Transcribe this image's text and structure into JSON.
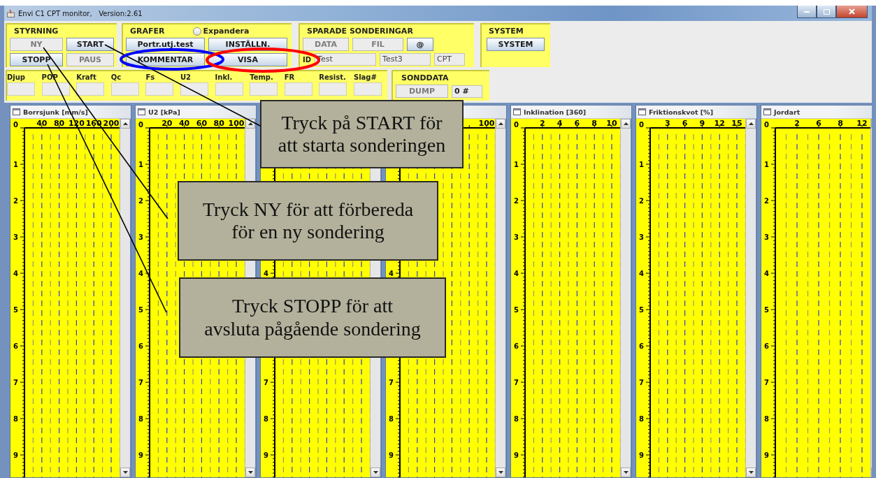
{
  "window": {
    "title": "Envi C1 CPT monitor,   Version:2.61"
  },
  "styrning": {
    "title": "STYRNING",
    "buttons": [
      {
        "label": "NY",
        "disabled": true
      },
      {
        "label": "START",
        "disabled": false
      },
      {
        "label": "STOPP",
        "disabled": false
      },
      {
        "label": "PAUS",
        "disabled": true
      }
    ]
  },
  "grafer": {
    "title": "GRAFER",
    "expand": {
      "label": "Expandera",
      "checked": false
    },
    "buttons": [
      {
        "label": "Portr.utj.test",
        "disabled": false
      },
      {
        "label": "INSTÄLLN.",
        "disabled": false
      },
      {
        "label": "KOMMENTAR",
        "disabled": false
      },
      {
        "label": "VISA",
        "disabled": false
      }
    ]
  },
  "sparade": {
    "title": "SPARADE SONDERINGAR",
    "buttons": [
      {
        "label": "DATA",
        "disabled": true
      },
      {
        "label": "FIL",
        "disabled": true
      },
      {
        "label": "@",
        "disabled": false
      }
    ],
    "id_label": "ID",
    "fields": [
      "Test",
      "Test3",
      "CPT"
    ]
  },
  "system": {
    "title": "SYSTEM",
    "button": "SYSTEM"
  },
  "readings": {
    "labels": [
      "Djup",
      "POP",
      "Kraft",
      "Qc",
      "Fs",
      "U2",
      "Inkl.",
      "Temp.",
      "FR",
      "Resist.",
      "Slag#"
    ]
  },
  "sonddata": {
    "title": "SONDDATA",
    "button": {
      "label": "DUMP",
      "disabled": true
    },
    "counter": "0 #"
  },
  "graphs": [
    {
      "title": "Borrsjunk [mm/s]",
      "xticks": [
        "40",
        "80",
        "120",
        "160",
        "200"
      ],
      "depth_labels": [
        "0",
        "1",
        "2",
        "3",
        "4",
        "5",
        "6",
        "7",
        "8",
        "9"
      ]
    },
    {
      "title": "U2 [kPa]",
      "xticks": [
        "20",
        "40",
        "60",
        "80",
        "100"
      ],
      "depth_labels": [
        "0",
        "1",
        "2",
        "3",
        "4",
        "5",
        "6",
        "7",
        "8",
        "9"
      ]
    },
    {
      "depth_labels": [
        "4",
        "7",
        "8",
        "9"
      ]
    },
    {
      "xticks": [
        "100"
      ],
      "depth_labels": [
        "4",
        "7",
        "8",
        "9"
      ]
    },
    {
      "title": "Inklination [360]",
      "xticks": [
        "2",
        "4",
        "6",
        "8",
        "10"
      ],
      "depth_labels": [
        "0",
        "1",
        "2",
        "3",
        "4",
        "5",
        "6",
        "7",
        "8",
        "9"
      ]
    },
    {
      "title": "Friktionskvot [%]",
      "xticks": [
        "3",
        "6",
        "9",
        "12",
        "15"
      ],
      "depth_labels": [
        "0",
        "1",
        "2",
        "3",
        "4",
        "5",
        "6",
        "7",
        "8",
        "9"
      ]
    },
    {
      "title": "Jordart",
      "xticks": [
        "2",
        "6",
        "8",
        "12"
      ],
      "depth_labels": [
        "0",
        "1",
        "2",
        "3",
        "4",
        "5",
        "6",
        "7",
        "8",
        "9"
      ]
    }
  ],
  "callouts": [
    {
      "text": "Tryck på START för\natt starta sonderingen"
    },
    {
      "text": "Tryck NY för att förbereda\nför en ny sondering"
    },
    {
      "text": "Tryck STOPP för att\navsluta pågående sondering"
    }
  ],
  "highlights": [
    {
      "color": "#0000ff"
    },
    {
      "color": "#ff0000"
    }
  ]
}
